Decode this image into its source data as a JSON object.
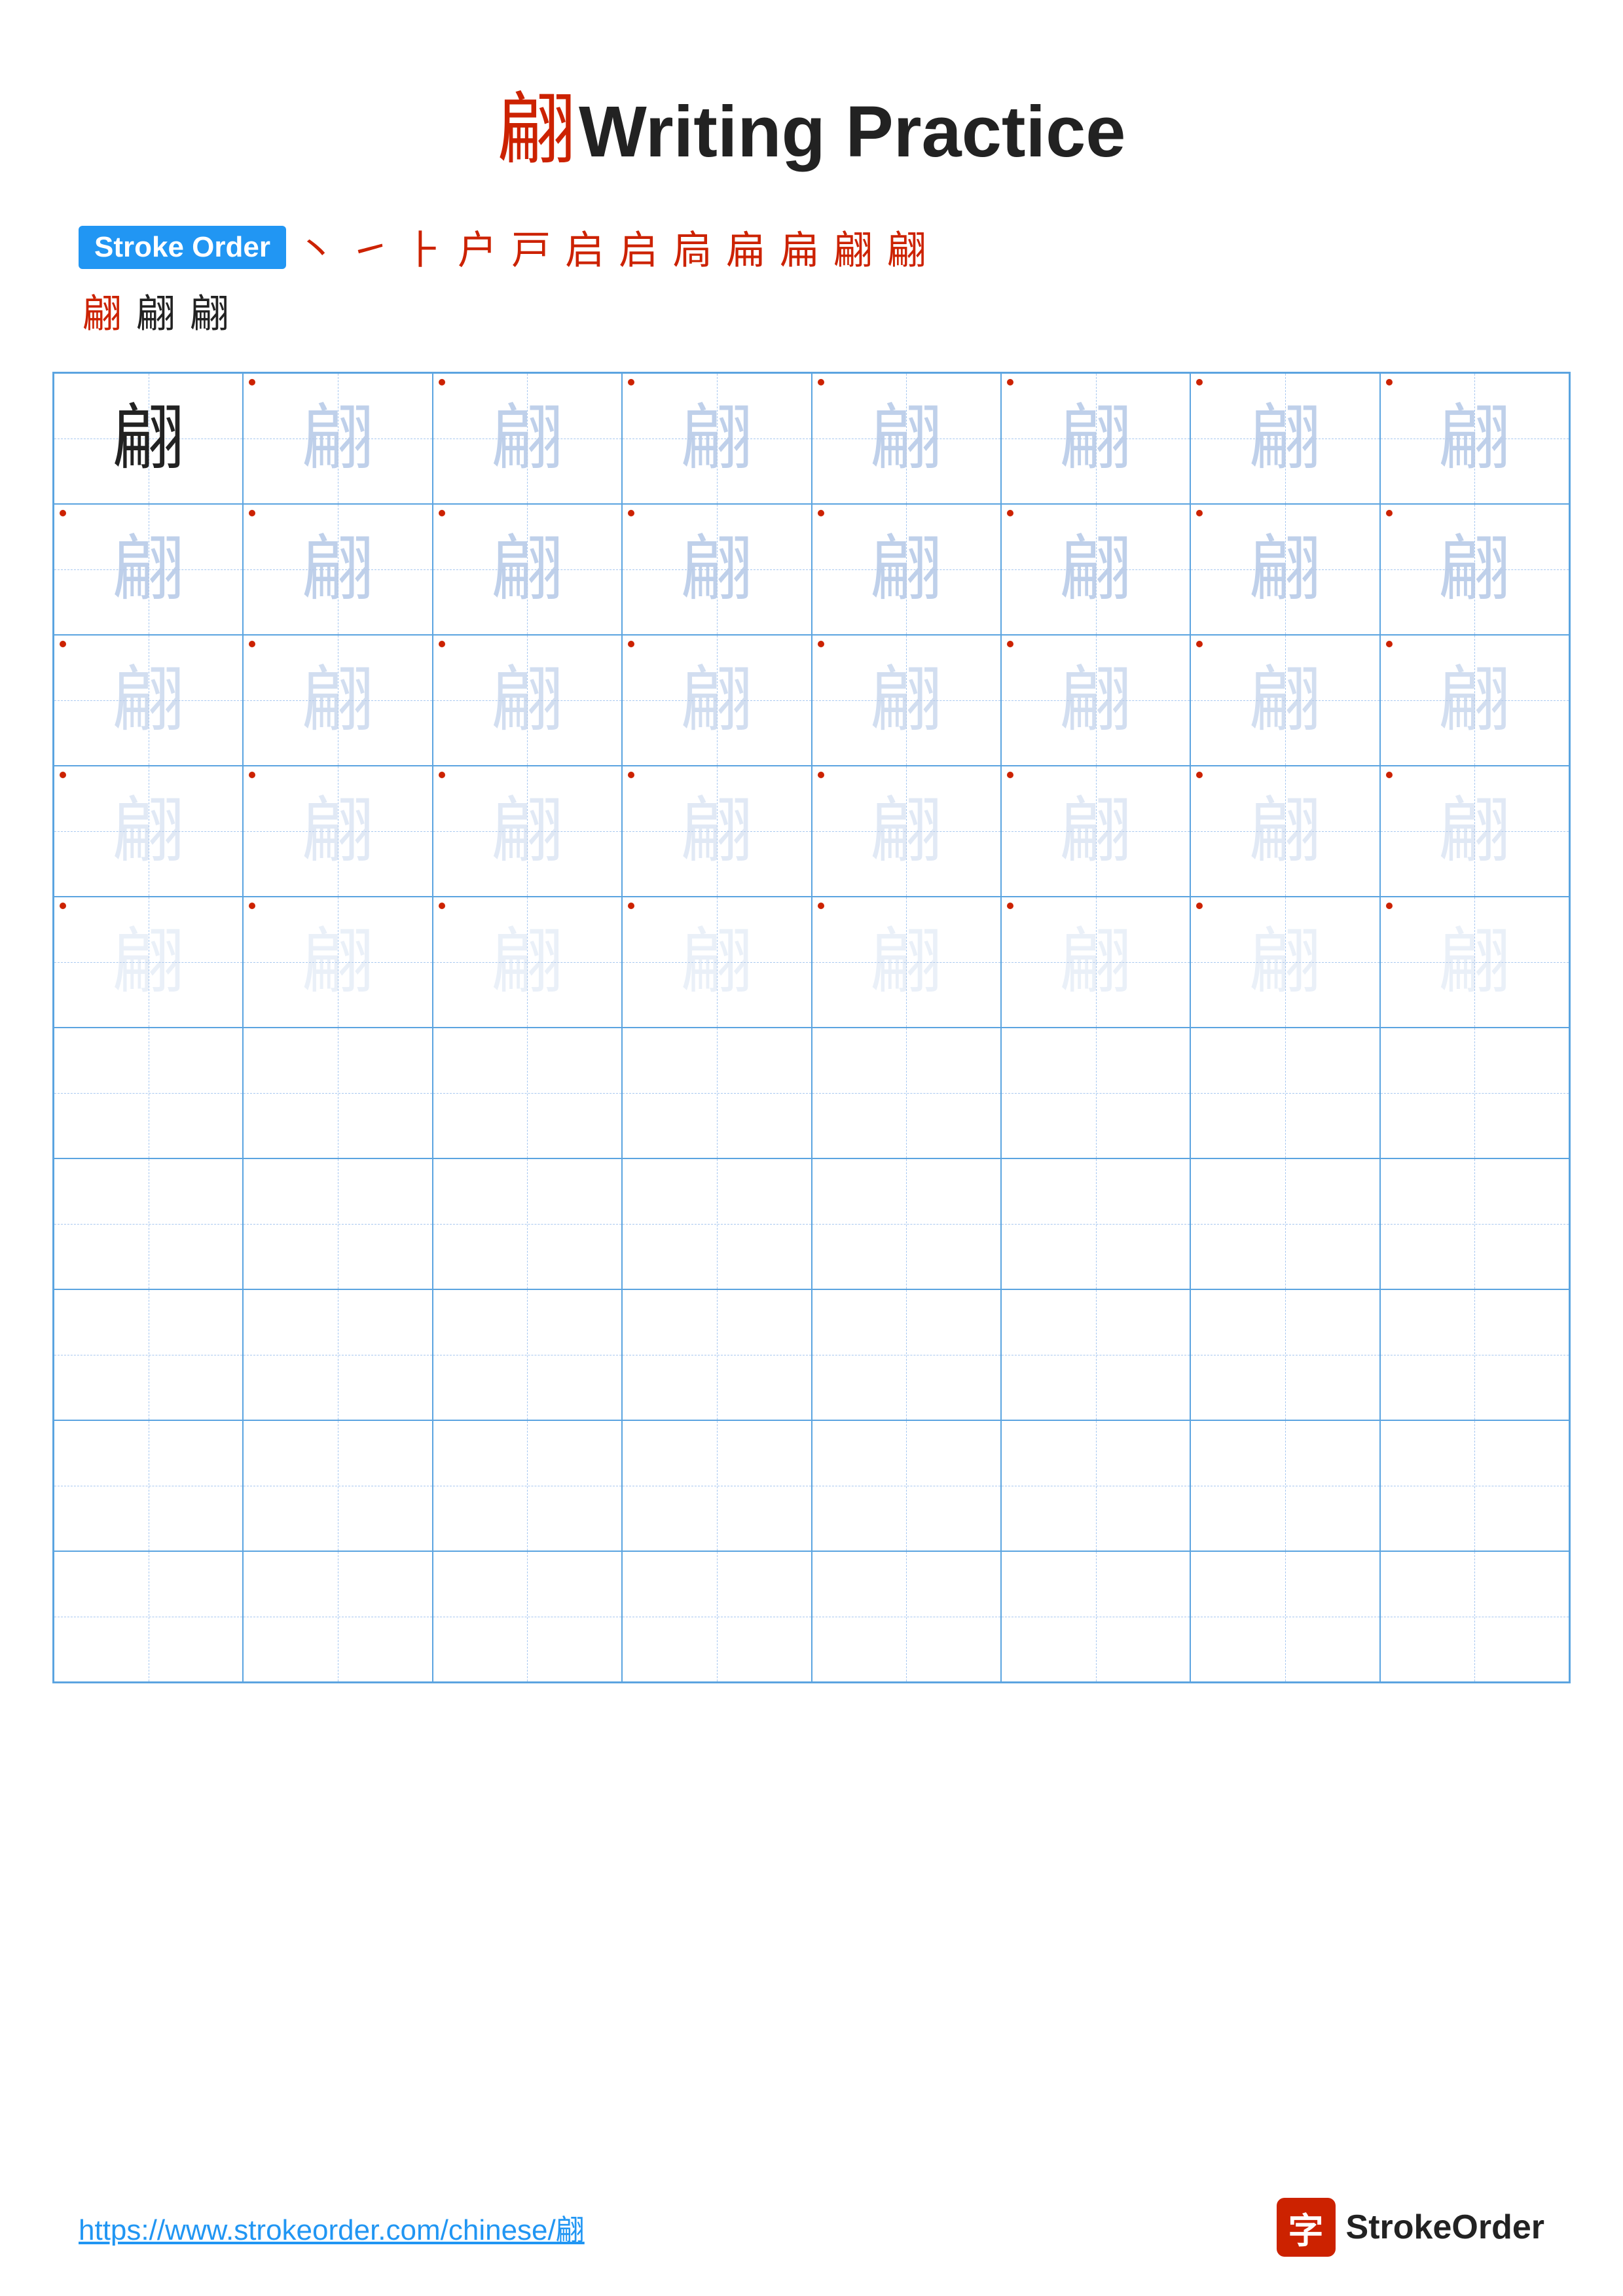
{
  "page": {
    "title_char": "翩",
    "title_text": "Writing Practice",
    "stroke_order_label": "Stroke Order",
    "stroke_sequence": [
      "丶",
      "㇀",
      "⺊",
      "户",
      "戸",
      "启",
      "启",
      "扃",
      "扁",
      "扁",
      "翩",
      "翩",
      "翩"
    ],
    "main_char": "翩",
    "footer_url": "https://www.strokeorder.com/chinese/翩",
    "footer_logo_char": "字",
    "footer_logo_text": "StrokeOrder"
  },
  "grid": {
    "rows": 10,
    "cols": 8,
    "char": "翩"
  }
}
